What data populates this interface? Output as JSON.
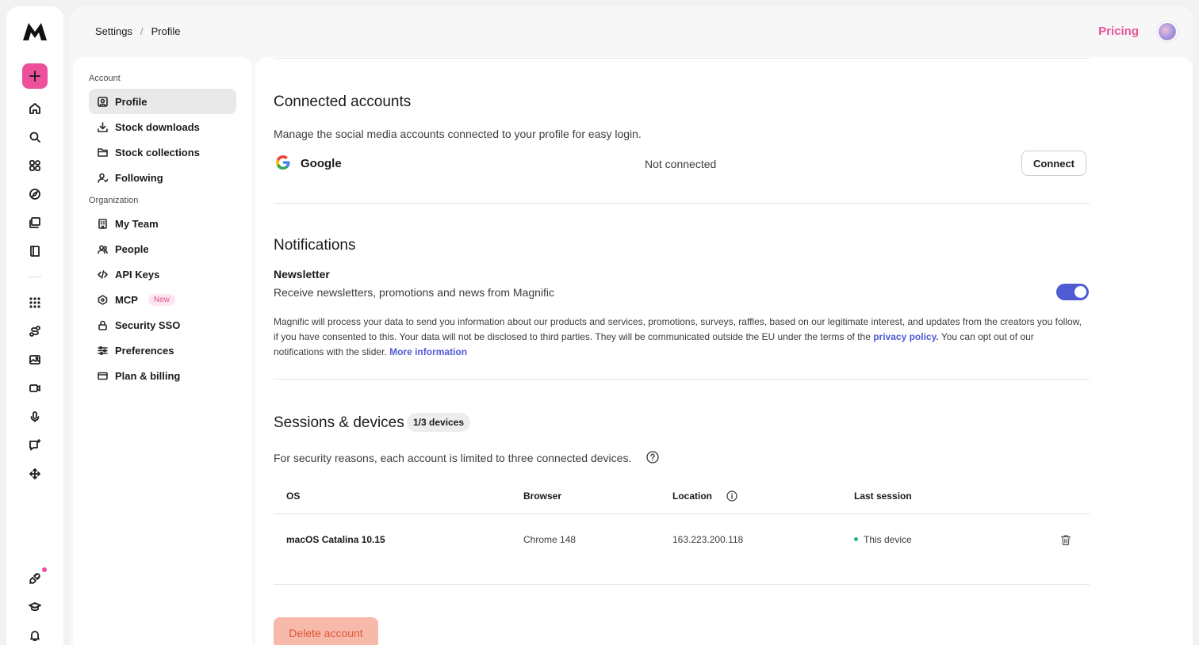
{
  "header": {
    "breadcrumb": [
      "Settings",
      "Profile"
    ],
    "pricing_label": "Pricing"
  },
  "rail": {
    "icons": [
      "home-icon",
      "search-icon",
      "apps-icon",
      "explore-icon",
      "library-icon",
      "book-icon",
      "grid-icon",
      "workflow-icon",
      "image-icon",
      "video-icon",
      "microphone-icon",
      "chat-sparkle-icon",
      "move-icon",
      "plugin-icon",
      "learn-icon",
      "bell-icon"
    ]
  },
  "settings_nav": {
    "account_label": "Account",
    "organization_label": "Organization",
    "account_items": [
      {
        "label": "Profile",
        "icon": "profile-icon"
      },
      {
        "label": "Stock downloads",
        "icon": "download-icon"
      },
      {
        "label": "Stock collections",
        "icon": "folder-icon"
      },
      {
        "label": "Following",
        "icon": "user-follow-icon"
      }
    ],
    "org_items": [
      {
        "label": "My Team",
        "icon": "building-icon"
      },
      {
        "label": "People",
        "icon": "people-icon"
      },
      {
        "label": "API Keys",
        "icon": "code-icon"
      },
      {
        "label": "MCP",
        "icon": "mcp-icon",
        "badge": "New"
      },
      {
        "label": "Security SSO",
        "icon": "lock-icon"
      },
      {
        "label": "Preferences",
        "icon": "sliders-icon"
      },
      {
        "label": "Plan & billing",
        "icon": "card-icon"
      }
    ]
  },
  "connected": {
    "title": "Connected accounts",
    "description": "Manage the social media accounts connected to your profile for easy login.",
    "provider": "Google",
    "status": "Not connected",
    "button": "Connect"
  },
  "notifications": {
    "title": "Notifications",
    "newsletter_title": "Newsletter",
    "newsletter_desc": "Receive newsletters, promotions and news from Magnific",
    "newsletter_enabled": true,
    "legal_part1": "Magnific will process your data to send you information about our products and services, promotions, surveys, raffles, based on our legitimate interest, and updates from the creators you follow, if you have consented to this. Your data will not be disclosed to third parties. They will be communicated outside the EU under the terms of the ",
    "privacy_link": "privacy policy.",
    "legal_part2": " You can opt out of our notifications with the slider. ",
    "more_info_link": "More information"
  },
  "sessions": {
    "title": "Sessions & devices",
    "badge": "1/3 devices",
    "description": "For security reasons, each account is limited to three connected devices.",
    "columns": [
      "OS",
      "Browser",
      "Location",
      "Last session"
    ],
    "rows": [
      {
        "os": "macOS Catalina 10.15",
        "browser": "Chrome 148",
        "location": "163.223.200.118",
        "last_session": "This device"
      }
    ]
  },
  "danger": {
    "delete_label": "Delete account"
  },
  "colors": {
    "accent_pink": "#e8559c",
    "toggle_blue": "#4f5bd5",
    "delete_bg": "#f7b9aa",
    "delete_text": "#e2553a"
  }
}
